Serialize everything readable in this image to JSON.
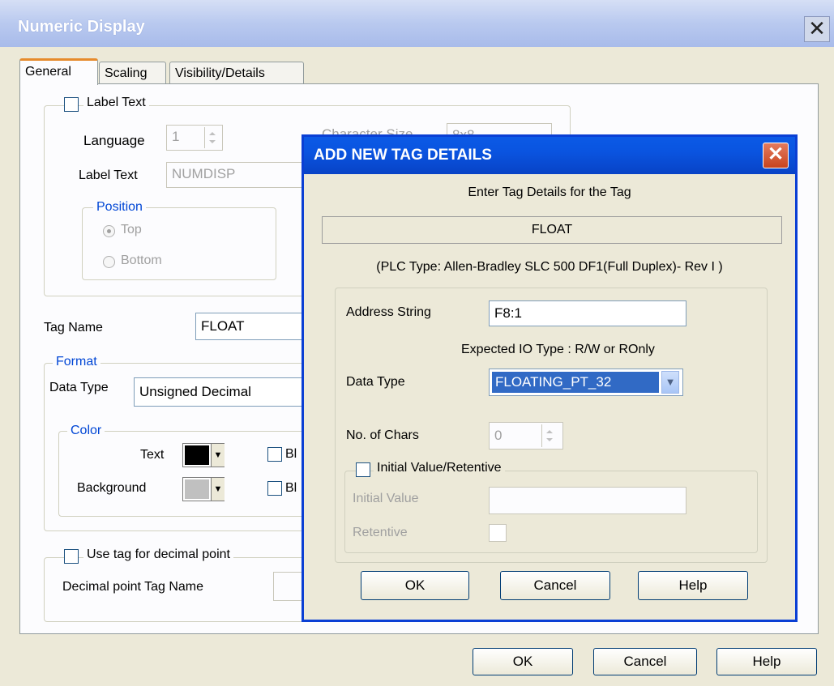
{
  "window": {
    "title": "Numeric Display",
    "close": "✕"
  },
  "tabs": [
    "General",
    "Scaling",
    "Visibility/Details"
  ],
  "label_group": {
    "checkbox_label": "Label Text",
    "language_label": "Language",
    "language_value": "1",
    "label_text_label": "Label Text",
    "label_text_value": "NUMDISP",
    "char_size_label": "Character Size",
    "char_size_value": "8x8",
    "position_legend": "Position",
    "position_top": "Top",
    "position_bottom": "Bottom"
  },
  "tag": {
    "label": "Tag Name",
    "value": "FLOAT"
  },
  "format": {
    "legend": "Format",
    "data_type_label": "Data Type",
    "data_type_value": "Unsigned Decimal",
    "color_legend": "Color",
    "text_label": "Text",
    "background_label": "Background",
    "blink_label": "Bl",
    "text_color": "#000000",
    "background_color": "#c0c0c0"
  },
  "decimal": {
    "checkbox_label": "Use tag for decimal point",
    "tag_name_label": "Decimal point Tag Name"
  },
  "buttons": {
    "ok": "OK",
    "cancel": "Cancel",
    "help": "Help"
  },
  "dialog": {
    "title": "ADD NEW TAG DETAILS",
    "close": "✕",
    "prompt": "Enter Tag Details for the Tag",
    "tag": "FLOAT",
    "plc_type": "(PLC Type:  Allen-Bradley SLC 500 DF1(Full Duplex)- Rev I )",
    "address_label": "Address String",
    "address_value": "F8:1",
    "expected_io": "Expected IO Type : R/W or ROnly",
    "data_type_label": "Data Type",
    "data_type_value": "FLOATING_PT_32",
    "chars_label": "No. of Chars",
    "chars_value": "0",
    "initial_retentive": "Initial Value/Retentive",
    "initial_value_label": "Initial Value",
    "retentive_label": "Retentive",
    "ok": "OK",
    "cancel": "Cancel",
    "help": "Help"
  }
}
